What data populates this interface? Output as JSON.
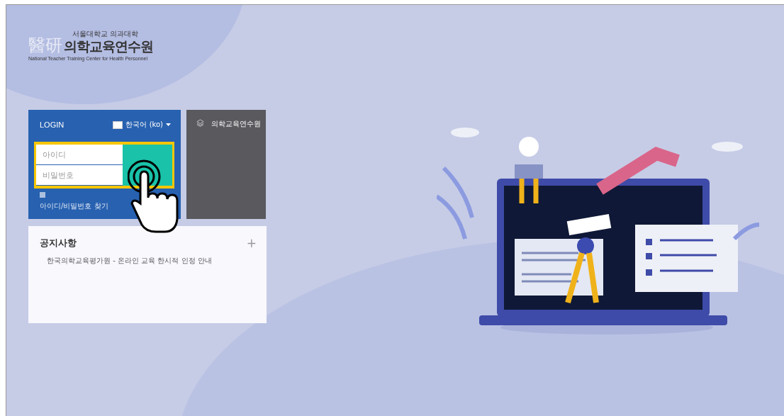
{
  "logo": {
    "mark": "醫研",
    "university": "서울대학교 의과대학",
    "name": "의학교육연수원",
    "subtitle": "National Teacher Training Center for Health Personnel"
  },
  "login": {
    "title": "LOGIN",
    "language": "한국어 (ko)",
    "id_placeholder": "아이디",
    "password_placeholder": "비밀번호",
    "find_link": "아이디/비밀번호 찾기",
    "remember_checked": false,
    "highlighted": true
  },
  "side_panel": {
    "label": "의학교육연수원"
  },
  "notice": {
    "title": "공지사항",
    "more": "+",
    "items": [
      "한국의학교육평가원 - 온라인 교육 한시적 인정 안내"
    ]
  }
}
